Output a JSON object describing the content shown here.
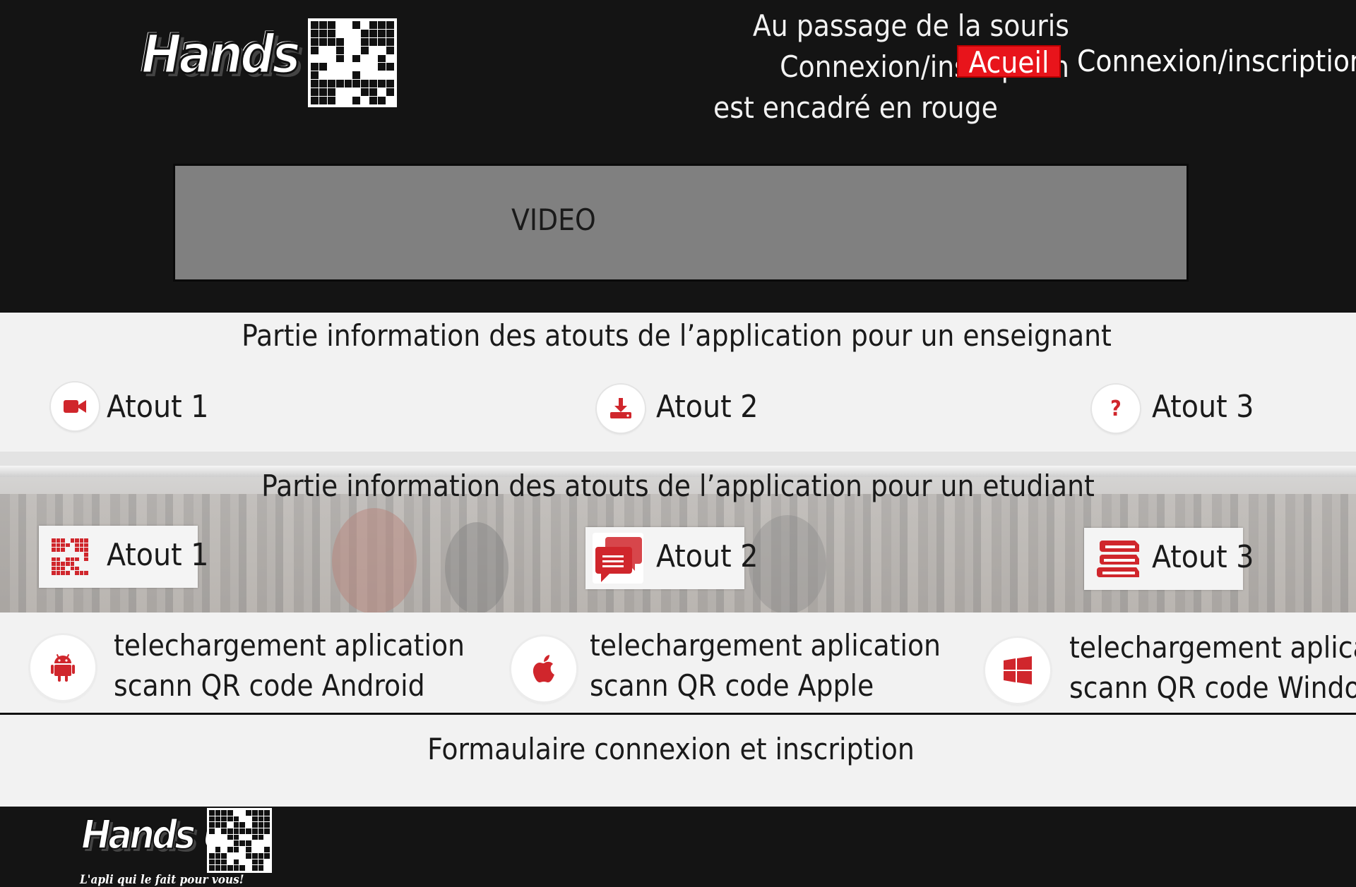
{
  "header": {
    "logo_text": "Hands Up",
    "note_line1": "Au passage de la souris Connexion/inscription",
    "note_line2": "est encadré en rouge",
    "nav_home": "Acueil",
    "nav_login": "Connexion/inscription",
    "video_label": "VIDEO"
  },
  "teacher": {
    "title": "Partie information des atouts de l’application pour un enseignant",
    "items": [
      {
        "label": "Atout 1",
        "icon": "video-camera-icon"
      },
      {
        "label": "Atout 2",
        "icon": "download-icon"
      },
      {
        "label": "Atout 3",
        "icon": "question-icon"
      }
    ]
  },
  "student": {
    "title": "Partie information des atouts de l’application pour un etudiant",
    "items": [
      {
        "label": "Atout 1",
        "icon": "qr-code-icon"
      },
      {
        "label": "Atout 2",
        "icon": "chat-bubbles-icon"
      },
      {
        "label": "Atout 3",
        "icon": "books-icon"
      }
    ]
  },
  "downloads": [
    {
      "line1": "telechargement aplication",
      "line2": "scann QR code Android",
      "icon": "android-icon"
    },
    {
      "line1": "telechargement aplication",
      "line2": "scann QR code Apple",
      "icon": "apple-icon"
    },
    {
      "line1": "telechargement aplication",
      "line2": "scann QR code Windows",
      "icon": "windows-icon"
    }
  ],
  "form": {
    "title": "Formaulaire connexion et inscription"
  },
  "footer": {
    "logo_text": "Hands Up",
    "tagline": "L'apli qui le fait pour vous!"
  },
  "colors": {
    "accent": "#e8141b",
    "icon_red": "#d0262c",
    "dark": "#141414",
    "light": "#f2f2f2"
  }
}
